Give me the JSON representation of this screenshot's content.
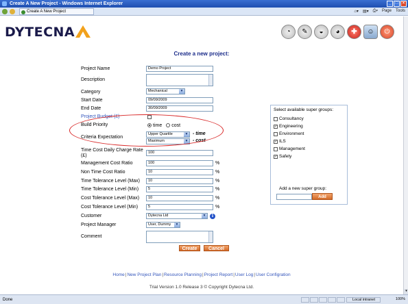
{
  "window": {
    "title": "Create A New Project - Windows Internet Explorer",
    "tab_label": "Create A New Project",
    "toolbar_items": [
      "Page",
      "Tools"
    ]
  },
  "brand": {
    "logo_text": "DYTECNA"
  },
  "page_title": "Create a new project:",
  "form": {
    "project_name": {
      "label": "Project Name",
      "value": "Demo Project"
    },
    "description": {
      "label": "Description",
      "value": ""
    },
    "category": {
      "label": "Category",
      "value": "Mechanical"
    },
    "start_date": {
      "label": "Start Date",
      "value": "09/09/2009"
    },
    "end_date": {
      "label": "End Date",
      "value": "30/09/2009"
    },
    "project_budget": {
      "label": "Project Budget (£)",
      "checked": false
    },
    "build_priority": {
      "label": "Build Priority",
      "options": [
        "time",
        "cost"
      ],
      "selected": "time"
    },
    "criteria_expectation": {
      "label": "Criteria Expectation",
      "time_value": "Upper Quartile",
      "time_tag": "- time",
      "cost_value": "Maximum",
      "cost_tag": "- cost"
    },
    "time_cost_daily_charge": {
      "label": "Time Cost Daily Charge Rate (£)",
      "value": "100"
    },
    "management_cost_ratio": {
      "label": "Management Cost Ratio",
      "value": "100",
      "unit": "%"
    },
    "non_time_cost_ratio": {
      "label": "Non Time Cost Ratio",
      "value": "10",
      "unit": "%"
    },
    "time_tolerance_max": {
      "label": "Time Tolerance Level (Max)",
      "value": "10",
      "unit": "%"
    },
    "time_tolerance_min": {
      "label": "Time Tolerance Level (Min)",
      "value": "5",
      "unit": "%"
    },
    "cost_tolerance_max": {
      "label": "Cost Tolerance Level (Max)",
      "value": "10",
      "unit": "%"
    },
    "cost_tolerance_min": {
      "label": "Cost Tolerance Level (Min)",
      "value": "5",
      "unit": "%"
    },
    "customer": {
      "label": "Customer",
      "value": "Dytecna Ltd"
    },
    "project_manager": {
      "label": "Project Manager",
      "value": "User, Dummy"
    },
    "comment": {
      "label": "Comment",
      "value": ""
    },
    "create_label": "Create",
    "cancel_label": "Cancel"
  },
  "super_groups": {
    "title": "Select available super groups:",
    "items": [
      {
        "label": "Consultancy",
        "checked": false
      },
      {
        "label": "Engineering",
        "checked": true
      },
      {
        "label": "Environment",
        "checked": false
      },
      {
        "label": "ILS",
        "checked": true
      },
      {
        "label": "Management",
        "checked": false
      },
      {
        "label": "Safety",
        "checked": true
      }
    ],
    "add_label": "Add a new super group:",
    "add_button": "Add"
  },
  "footer": {
    "links": [
      "Home",
      "New Project Plan",
      "Resource Planning",
      "Project Report",
      "User Log",
      "User Configration"
    ],
    "copyright": "Trial Version 1.0 Release 3 © Copyright Dytecna Ltd."
  },
  "status": {
    "left": "Done",
    "zone": "Local intranet",
    "zoom": "100%"
  },
  "colors": {
    "accent": "#d36a28",
    "title_blue": "#1b2c8a",
    "highlight_red": "#d82626"
  }
}
